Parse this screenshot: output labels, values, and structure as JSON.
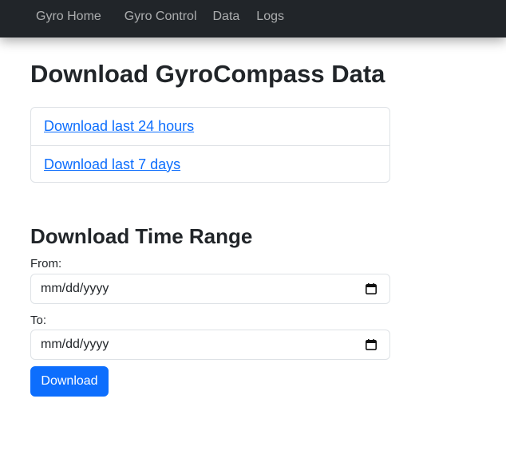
{
  "nav": {
    "items": [
      {
        "label": "Gyro Home"
      },
      {
        "label": "Gyro Control"
      },
      {
        "label": "Data"
      },
      {
        "label": "Logs"
      }
    ]
  },
  "page": {
    "title": "Download GyroCompass Data"
  },
  "quick_downloads": [
    {
      "label": "Download last 24 hours"
    },
    {
      "label": "Download last 7 days"
    }
  ],
  "time_range": {
    "title": "Download Time Range",
    "from_label": "From:",
    "from_value": "mm/dd/yyyy",
    "to_label": "To:",
    "to_value": "mm/dd/yyyy",
    "button_label": "Download"
  },
  "icons": {
    "date_picker": "calendar-icon"
  },
  "colors": {
    "navbar_bg": "#212529",
    "nav_text": "#9fa1a3",
    "link": "#0d6efd",
    "primary_button": "#0d6efd",
    "border": "#dee2e6"
  }
}
